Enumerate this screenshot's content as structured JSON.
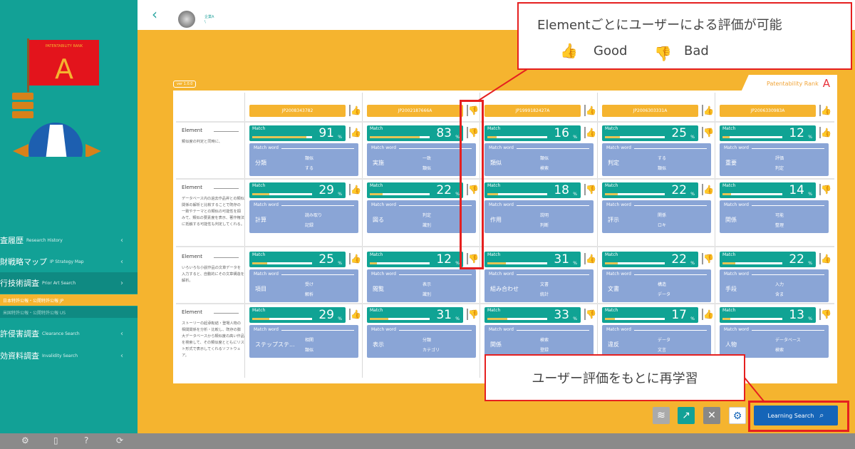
{
  "sidebar": {
    "logo": {
      "flag_title": "PATENTABILITY RANK",
      "rank": "A"
    },
    "items": [
      {
        "jp": "査履歴",
        "en": "Research History",
        "chev": "‹"
      },
      {
        "jp": "財戦略マップ",
        "en": "IP Strategy Map",
        "chev": "‹"
      },
      {
        "jp": "行技術調査",
        "en": "Prior Art Search",
        "chev": "›"
      },
      {
        "jp": "許侵害調査",
        "en": "Clearance Search",
        "chev": "‹"
      },
      {
        "jp": "効資料調査",
        "en": "Invalidity Search",
        "chev": "‹"
      }
    ],
    "subitems": [
      "日本特許公報・公開特許公報 JP",
      "米国特許公報・公開特許公報 US"
    ]
  },
  "header": {
    "back": "‹",
    "user_name": "企業A",
    "user_sub": "\\"
  },
  "version": "ver 1.0.0",
  "rank": {
    "label": "Patentability Rank",
    "value": "A"
  },
  "colors": {
    "teal": "#12a196",
    "orange": "#f5b42f",
    "blue": "#8aa5d6",
    "good": "#e0862a",
    "bad": "#333333",
    "red": "#e52020",
    "button": "#1565b8"
  },
  "patents": [
    {
      "id": "JP2008343782",
      "rating": "good"
    },
    {
      "id": "JP2002187666A",
      "rating": "bad"
    },
    {
      "id": "JP1999182427A",
      "rating": "none"
    },
    {
      "id": "JP2006303331A",
      "rating": "none"
    },
    {
      "id": "JP2006330983A",
      "rating": "none"
    }
  ],
  "labels": {
    "match": "Match",
    "pct": "%",
    "match_word": "Match word",
    "element": "Element"
  },
  "rows": [
    {
      "desc": "類似度の判定と同時に、",
      "cells": [
        {
          "v": 91,
          "r": "good",
          "w": "分類",
          "a": "類似",
          "b": "する"
        },
        {
          "v": 83,
          "r": "bad",
          "w": "実施",
          "a": "一致",
          "b": "類似"
        },
        {
          "v": 16,
          "r": "good",
          "w": "類似",
          "a": "類似",
          "b": "検索"
        },
        {
          "v": 25,
          "r": "bad",
          "w": "判定",
          "a": "する",
          "b": "類似"
        },
        {
          "v": 12,
          "r": "good",
          "w": "重要",
          "a": "評価",
          "b": "判定"
        }
      ]
    },
    {
      "desc": "データベース内の過去作品昇との類似関係の解析と比較することで既存の一致やテーマとの類似の可能性を掴みて、類似の要素度を表示、著作権法に抵触する可能性も判定してくれる。",
      "cells": [
        {
          "v": 29,
          "r": "good",
          "w": "計算",
          "a": "読み取り",
          "b": "記録"
        },
        {
          "v": 22,
          "r": "bad",
          "w": "図る",
          "a": "判定",
          "b": "識別"
        },
        {
          "v": 18,
          "r": "bad",
          "w": "作用",
          "a": "説明",
          "b": "判断"
        },
        {
          "v": 22,
          "r": "good",
          "w": "評示",
          "a": "関係",
          "b": "ロキ"
        },
        {
          "v": 14,
          "r": "bad",
          "w": "関係",
          "a": "可能",
          "b": "整理"
        }
      ]
    },
    {
      "desc": "いろいろな小説作品の文章データを入力すると、自動的にその文章構造を解析。",
      "cells": [
        {
          "v": 25,
          "r": "good",
          "w": "項目",
          "a": "受け",
          "b": "解析"
        },
        {
          "v": 12,
          "r": "bad",
          "w": "閲覧",
          "a": "表示",
          "b": "識別"
        },
        {
          "v": 31,
          "r": "good",
          "w": "組み合わせ",
          "a": "文書",
          "b": "統計"
        },
        {
          "v": 22,
          "r": "bad",
          "w": "文書",
          "a": "構造",
          "b": "データ"
        },
        {
          "v": 22,
          "r": "good",
          "w": "手段",
          "a": "入力",
          "b": "含ま"
        }
      ]
    },
    {
      "desc": "ストーリーの起承転結・登場人物の相関関係を分析・比較し、既存の膨大データベースから類似度の高い作品を検索して、その類似度とともにリスト形式で表示してくれるソフトウェア。",
      "cells": [
        {
          "v": 29,
          "r": "good",
          "w": "ステップステ...",
          "a": "相関",
          "b": "類似"
        },
        {
          "v": 31,
          "r": "bad",
          "w": "表示",
          "a": "分類",
          "b": "カテゴリ"
        },
        {
          "v": 33,
          "r": "bad",
          "w": "関係",
          "a": "検索",
          "b": "登録"
        },
        {
          "v": 17,
          "r": "good",
          "w": "違反",
          "a": "データ",
          "b": "文言"
        },
        {
          "v": 13,
          "r": "bad",
          "w": "人物",
          "a": "データベース",
          "b": "検索"
        }
      ]
    }
  ],
  "callouts": {
    "top": "Elementごとにユーザーによる評価が可能",
    "good": "Good",
    "bad": "Bad",
    "bottom": "ユーザー評価をもとに再学習"
  },
  "toolbar": {
    "learning_search": "Learning Search"
  }
}
